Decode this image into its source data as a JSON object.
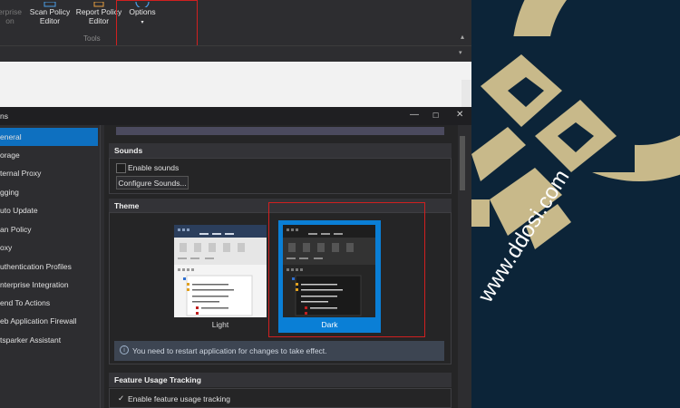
{
  "ribbon": {
    "buttons": [
      {
        "label": "erprise",
        "label2": "on"
      },
      {
        "label": "Scan Policy",
        "label2": "Editor"
      },
      {
        "label": "Report Policy",
        "label2": "Editor"
      },
      {
        "label": "Options",
        "label2": "▾"
      }
    ],
    "group_label": "Tools",
    "collapse_glyph": "▴"
  },
  "tabstrip": {
    "dropdown_glyph": "▾"
  },
  "dialog": {
    "title": "ns",
    "controls": {
      "minimize": "—",
      "maximize": "☐",
      "close": "✕"
    },
    "nav": [
      {
        "label": "eneral",
        "selected": true
      },
      {
        "label": "orage"
      },
      {
        "label": "ternal Proxy"
      },
      {
        "label": "gging"
      },
      {
        "label": "uto Update"
      },
      {
        "label": "an Policy"
      },
      {
        "label": "oxy"
      },
      {
        "label": "uthentication Profiles"
      },
      {
        "label": "nterprise Integration"
      },
      {
        "label": "end To Actions"
      },
      {
        "label": "eb Application Firewall"
      },
      {
        "label": "tsparker Assistant"
      }
    ],
    "sounds": {
      "heading": "Sounds",
      "enable_label": "Enable sounds",
      "configure_button": "Configure Sounds..."
    },
    "theme": {
      "heading": "Theme",
      "light_label": "Light",
      "dark_label": "Dark",
      "selected": "Dark",
      "restart_notice": "You need to restart application for changes to take effect.",
      "info_icon": "i"
    },
    "feature_usage": {
      "heading": "Feature Usage Tracking",
      "check_glyph": "✓",
      "enable_label": "Enable feature usage tracking"
    }
  },
  "watermark": {
    "text": "www.ddosi.com"
  },
  "colors": {
    "accent": "#0e70c0",
    "highlight": "#d02020",
    "logo_gold": "#c8b98a",
    "logo_bg": "#0c2438"
  }
}
